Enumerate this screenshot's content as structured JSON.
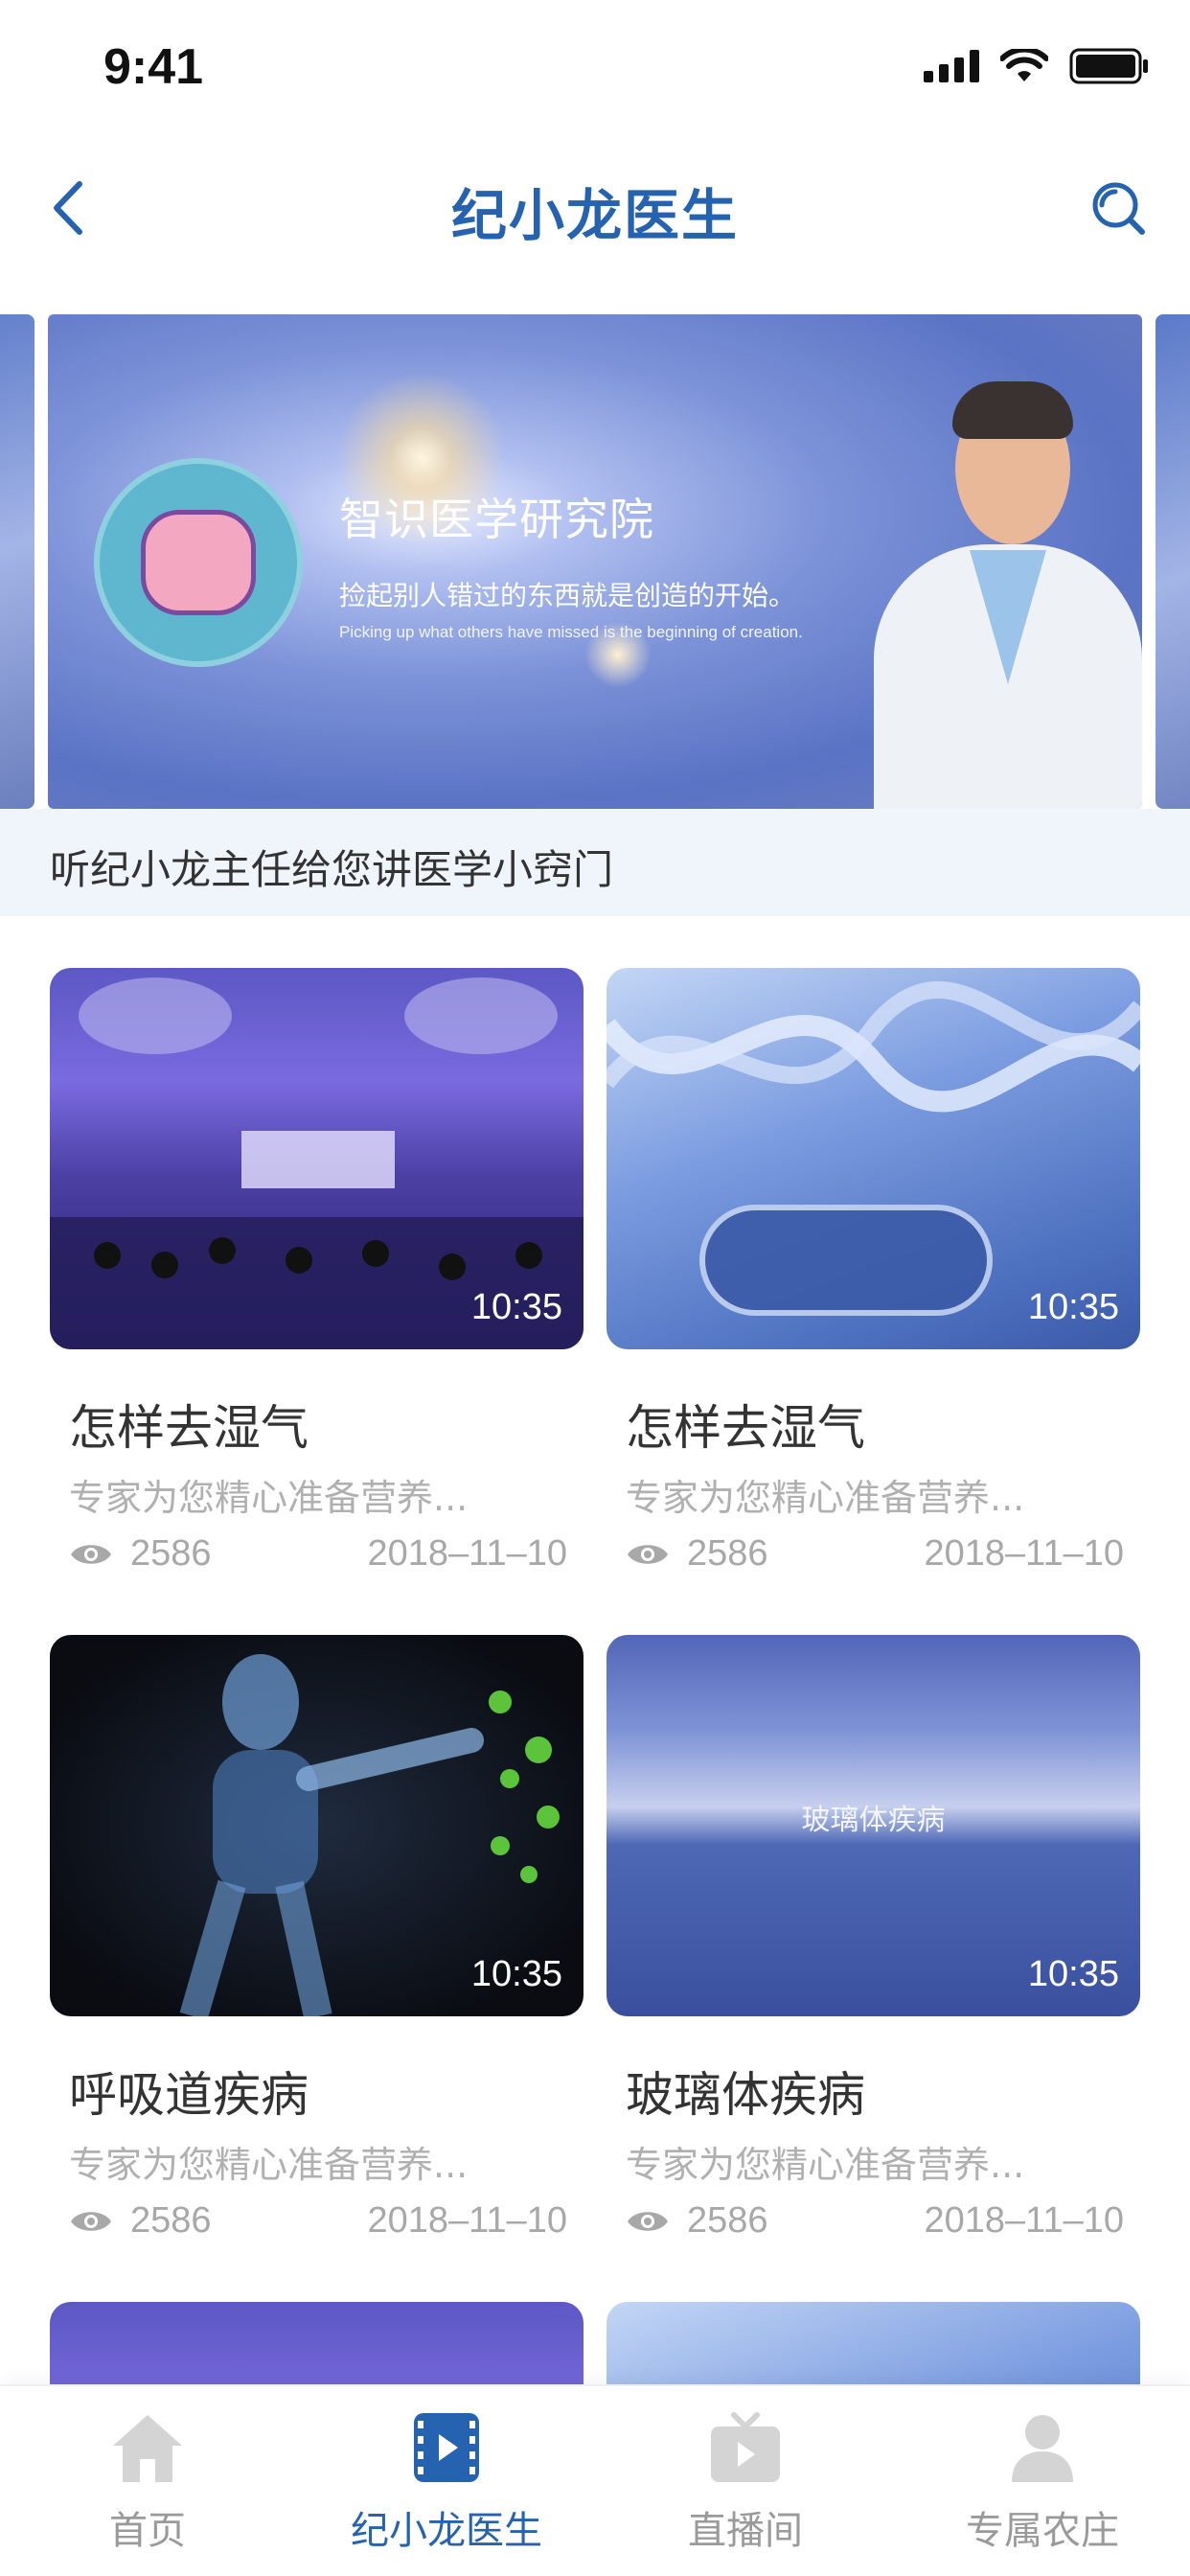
{
  "status_bar": {
    "time": "9:41"
  },
  "nav": {
    "title": "纪小龙医生"
  },
  "banner": {
    "heading": "智识医学研究院",
    "subtitle": "捡起别人错过的东西就是创造的开始。",
    "subtitle_en": "Picking up what others have missed is the beginning of creation.",
    "caption": "听纪小龙主任给您讲医学小窍门"
  },
  "videos": [
    {
      "title": "怎样去湿气",
      "desc": "专家为您精心准备营养...",
      "views": "2586",
      "date": "2018–11–10",
      "duration": "10:35"
    },
    {
      "title": "怎样去湿气",
      "desc": "专家为您精心准备营养...",
      "views": "2586",
      "date": "2018–11–10",
      "duration": "10:35"
    },
    {
      "title": "呼吸道疾病",
      "desc": "专家为您精心准备营养...",
      "views": "2586",
      "date": "2018–11–10",
      "duration": "10:35"
    },
    {
      "title": "玻璃体疾病",
      "desc": "专家为您精心准备营养...",
      "views": "2586",
      "date": "2018–11–10",
      "duration": "10:35",
      "thumb_text": "玻璃体疾病"
    }
  ],
  "tabs": [
    {
      "label": "首页",
      "icon": "home-icon"
    },
    {
      "label": "纪小龙医生",
      "icon": "video-icon",
      "active": true
    },
    {
      "label": "直播间",
      "icon": "tv-icon"
    },
    {
      "label": "专属农庄",
      "icon": "user-icon"
    }
  ],
  "colors": {
    "accent": "#2563b0",
    "muted": "#9a9a9a",
    "caption_bg": "#f0f4fb"
  }
}
